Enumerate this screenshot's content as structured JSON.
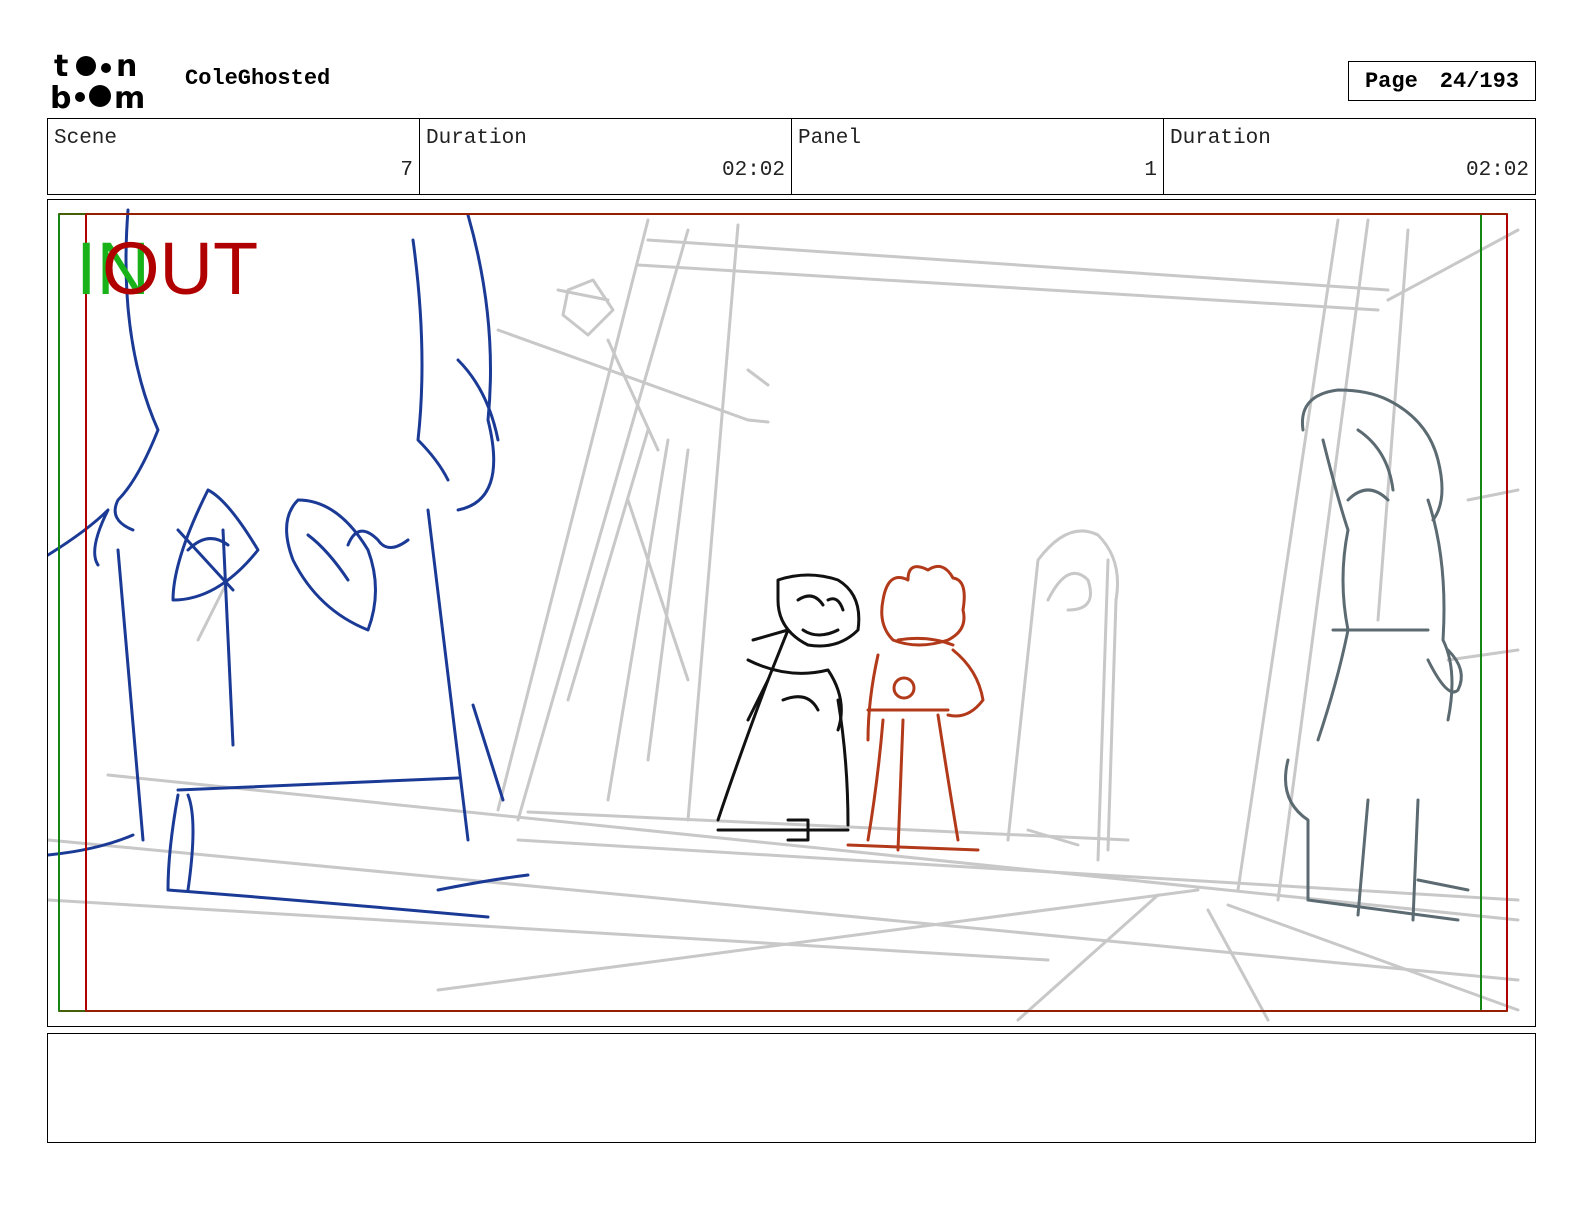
{
  "header": {
    "logo_text": "toon boom",
    "project_title": "ColeGhosted",
    "page_label": "Page",
    "page_number": "24/193"
  },
  "info": {
    "scene_label": "Scene",
    "scene_value": "7",
    "scene_duration_label": "Duration",
    "scene_duration_value": "02:02",
    "panel_label": "Panel",
    "panel_value": "1",
    "panel_duration_label": "Duration",
    "panel_duration_value": "02:02"
  },
  "panel": {
    "in_marker": "IN",
    "out_marker": "OUT"
  },
  "notes": {
    "text": ""
  },
  "colors": {
    "in_green": "#19b219",
    "out_red": "#b00000",
    "sketch_blue": "#1a3a96",
    "sketch_red": "#b23a1a",
    "sketch_grey": "#c8c8c8",
    "sketch_dark_grey": "#5c6a72"
  },
  "icons": {
    "logo": "toon-boom-logo"
  }
}
